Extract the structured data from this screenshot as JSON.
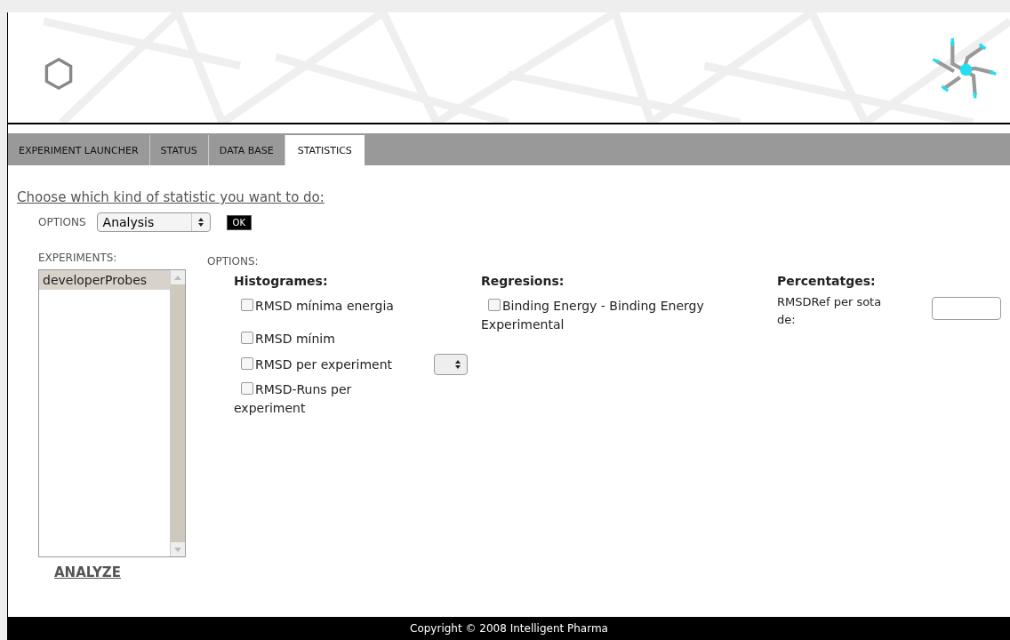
{
  "tabs": [
    {
      "label": "EXPERIMENT LAUNCHER",
      "selected": false
    },
    {
      "label": "STATUS",
      "selected": false
    },
    {
      "label": "DATA BASE",
      "selected": false
    },
    {
      "label": "STATISTICS",
      "selected": true
    }
  ],
  "prompt": "Choose which kind of statistic you want to do:",
  "options_row": {
    "label": "OPTIONS",
    "select_value": "Analysis",
    "ok_button": "OK"
  },
  "experiments": {
    "label": "EXPERIMENTS:",
    "items": [
      {
        "label": "developerProbes",
        "selected": true
      }
    ],
    "analyze_link": "ANALYZE"
  },
  "options": {
    "label": "OPTIONS:",
    "histogrames": {
      "title": "Histogrames:",
      "items": [
        {
          "kind": "checkbox",
          "label": "RMSD mínima energia",
          "checked": false
        },
        {
          "kind": "checkbox",
          "label": "RMSD mínim",
          "checked": false
        },
        {
          "kind": "checkbox_select",
          "label": "RMSD per experiment",
          "checked": false
        },
        {
          "kind": "checkbox",
          "label": "RMSD-Runs per experiment",
          "checked": false
        }
      ]
    },
    "regresions": {
      "title": "Regresions:",
      "items": [
        {
          "kind": "checkbox",
          "label": "Binding Energy - Binding Energy Experimental",
          "checked": false
        }
      ]
    },
    "percentatges": {
      "title": "Percentatges:",
      "field_label": "RMSDRef per sota de:"
    }
  },
  "footer": "Copyright © 2008 Intelligent Pharma"
}
